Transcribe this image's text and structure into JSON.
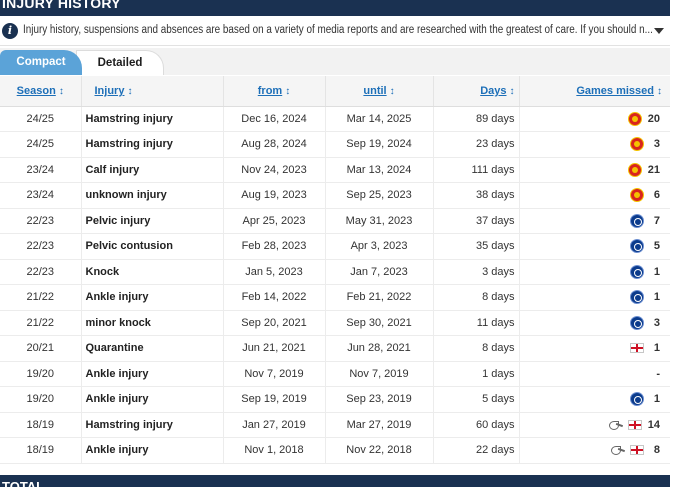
{
  "header": {
    "title": "INJURY HISTORY"
  },
  "info": {
    "text": "Injury history, suspensions and absences are based on a variety of media reports and are researched with the greatest of care. If you should n...",
    "icon": "info-icon",
    "toggle_icon": "chevron-down-icon"
  },
  "tabs": [
    {
      "label": "Compact",
      "active": true
    },
    {
      "label": "Detailed",
      "active": false
    }
  ],
  "columns": {
    "season": "Season",
    "injury": "Injury",
    "from": "from",
    "until": "until",
    "days": "Days",
    "games": "Games missed",
    "sort_arrow": "↕"
  },
  "rows": [
    {
      "season": "24/25",
      "injury": "Hamstring injury",
      "from": "Dec 16, 2024",
      "until": "Mar 14, 2025",
      "days": "89 days",
      "club": "manchester-united",
      "games": "20"
    },
    {
      "season": "24/25",
      "injury": "Hamstring injury",
      "from": "Aug 28, 2024",
      "until": "Sep 19, 2024",
      "days": "23 days",
      "club": "manchester-united",
      "games": "3"
    },
    {
      "season": "23/24",
      "injury": "Calf injury",
      "from": "Nov 24, 2023",
      "until": "Mar 13, 2024",
      "days": "111 days",
      "club": "manchester-united",
      "games": "21"
    },
    {
      "season": "23/24",
      "injury": "unknown injury",
      "from": "Aug 19, 2023",
      "until": "Sep 25, 2023",
      "days": "38 days",
      "club": "manchester-united",
      "games": "6"
    },
    {
      "season": "22/23",
      "injury": "Pelvic injury",
      "from": "Apr 25, 2023",
      "until": "May 31, 2023",
      "days": "37 days",
      "club": "chelsea",
      "games": "7"
    },
    {
      "season": "22/23",
      "injury": "Pelvic contusion",
      "from": "Feb 28, 2023",
      "until": "Apr 3, 2023",
      "days": "35 days",
      "club": "chelsea",
      "games": "5"
    },
    {
      "season": "22/23",
      "injury": "Knock",
      "from": "Jan 5, 2023",
      "until": "Jan 7, 2023",
      "days": "3 days",
      "club": "chelsea",
      "games": "1"
    },
    {
      "season": "21/22",
      "injury": "Ankle injury",
      "from": "Feb 14, 2022",
      "until": "Feb 21, 2022",
      "days": "8 days",
      "club": "chelsea",
      "games": "1"
    },
    {
      "season": "21/22",
      "injury": "minor knock",
      "from": "Sep 20, 2021",
      "until": "Sep 30, 2021",
      "days": "11 days",
      "club": "chelsea",
      "games": "3"
    },
    {
      "season": "20/21",
      "injury": "Quarantine",
      "from": "Jun 21, 2021",
      "until": "Jun 28, 2021",
      "days": "8 days",
      "club": "england",
      "games": "1"
    },
    {
      "season": "19/20",
      "injury": "Ankle injury",
      "from": "Nov 7, 2019",
      "until": "Nov 7, 2019",
      "days": "1 days",
      "club": "",
      "games": "-"
    },
    {
      "season": "19/20",
      "injury": "Ankle injury",
      "from": "Sep 19, 2019",
      "until": "Sep 23, 2019",
      "days": "5 days",
      "club": "chelsea",
      "games": "1"
    },
    {
      "season": "18/19",
      "injury": "Hamstring injury",
      "from": "Jan 27, 2019",
      "until": "Mar 27, 2019",
      "days": "60 days",
      "club": "derby-england",
      "games": "14"
    },
    {
      "season": "18/19",
      "injury": "Ankle injury",
      "from": "Nov 1, 2018",
      "until": "Nov 22, 2018",
      "days": "22 days",
      "club": "derby-england",
      "games": "8"
    }
  ],
  "footer": {
    "title": "TOTAL"
  },
  "colors": {
    "header_bg": "#1a3151",
    "tab_active": "#5ba3d8",
    "link": "#1d6fb8"
  }
}
